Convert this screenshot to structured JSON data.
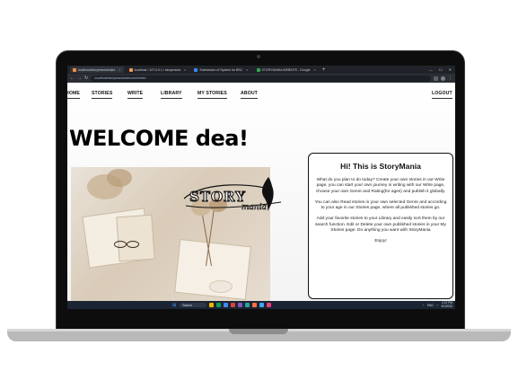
{
  "browser": {
    "tabs": [
      {
        "label": "localhost/storymania/index",
        "active": true,
        "color": "#ff8a3d"
      },
      {
        "label": "localhost / 127.0.0.1 / storymania",
        "active": false,
        "color": "#f2994a"
      },
      {
        "label": "Submission of System for BSC",
        "active": false,
        "color": "#4285f4"
      },
      {
        "label": "STORYMANIA WEBSITE - Google",
        "active": false,
        "color": "#34a853"
      }
    ],
    "new_tab": "+",
    "url": "localhost/storymania/welcome/index"
  },
  "nav": {
    "home": "HOME",
    "stories": "STORIES",
    "write": "WRITE",
    "library": "LIBRARY",
    "my_stories": "MY STORIES",
    "about": "ABOUT",
    "logout": "LOGOUT"
  },
  "welcome": "WELCOME  dea!",
  "logo": {
    "word1": "STORY",
    "word2": "mania"
  },
  "card": {
    "title": "Hi! This is StoryMania",
    "p1": "What do you plan to do today? Create your own stories in our Write page, you can start your own journey in writing with our Write page, choose your own Genre and Rating(for ages) and publish it globally.",
    "p2": "You can also Read stories in your own selected Genre and according to your age in our Stories page, where all published stories go.",
    "p3": "Add your favorite stories to your Library and easily sort them by our search function. Edit or Delete your own published stories in your My Stories page. Do anything you want with StoryMania",
    "p4": "Enjoy!"
  },
  "taskbar": {
    "search_label": "Search",
    "lang": "ENG",
    "time": "4:12 PM",
    "date": "6/1/2023"
  },
  "colors": {
    "taskbar": "#1b2433",
    "chrome": "#1f2329"
  }
}
